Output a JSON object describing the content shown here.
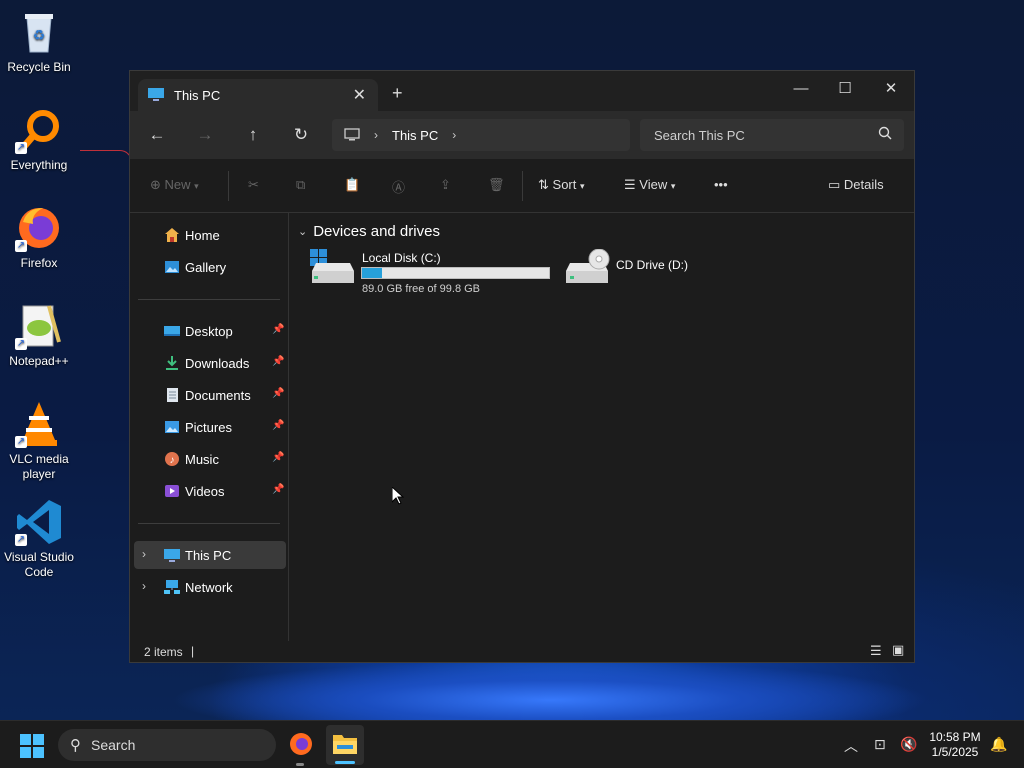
{
  "desktop": {
    "icons": [
      {
        "label": "Recycle Bin",
        "icon": "recycle-bin-icon"
      },
      {
        "label": "Everything",
        "icon": "everything-search-icon"
      },
      {
        "label": "Firefox",
        "icon": "firefox-icon"
      },
      {
        "label": "Notepad++",
        "icon": "notepad-plus-plus-icon"
      },
      {
        "label": "VLC media player",
        "icon": "vlc-icon"
      },
      {
        "label": "Visual Studio Code",
        "icon": "vscode-icon"
      }
    ]
  },
  "window": {
    "tab_title": "This PC",
    "tab_close": "✕",
    "new_tab": "+",
    "controls": {
      "minimize": "—",
      "maximize": "☐",
      "close": "✕"
    },
    "nav": {
      "back": "←",
      "forward": "→",
      "up": "↑",
      "refresh": "↻"
    },
    "breadcrumb": {
      "location": "This PC",
      "sep": "›"
    },
    "search_placeholder": "Search This PC",
    "toolbar": {
      "new_label": "New",
      "sort_label": "Sort",
      "view_label": "View",
      "more_label": "•••",
      "details_label": "Details"
    },
    "sidebar": {
      "quick": [
        {
          "label": "Home",
          "icon": "home-icon"
        },
        {
          "label": "Gallery",
          "icon": "gallery-icon"
        }
      ],
      "pinned": [
        {
          "label": "Desktop",
          "icon": "desktop-folder-icon"
        },
        {
          "label": "Downloads",
          "icon": "downloads-folder-icon"
        },
        {
          "label": "Documents",
          "icon": "documents-folder-icon"
        },
        {
          "label": "Pictures",
          "icon": "pictures-folder-icon"
        },
        {
          "label": "Music",
          "icon": "music-folder-icon"
        },
        {
          "label": "Videos",
          "icon": "videos-folder-icon"
        }
      ],
      "tree": [
        {
          "label": "This PC",
          "icon": "this-pc-icon"
        },
        {
          "label": "Network",
          "icon": "network-icon"
        }
      ]
    },
    "content": {
      "group_title": "Devices and drives",
      "drives": [
        {
          "name": "Local Disk (C:)",
          "free_text": "89.0 GB free of 99.8 GB",
          "used_fraction": 0.108
        },
        {
          "name": "CD Drive (D:)"
        }
      ]
    },
    "status": {
      "items_count": "2 items"
    }
  },
  "taskbar": {
    "search_label": "Search",
    "time": "10:58 PM",
    "date": "1/5/2025"
  },
  "colors": {
    "accent": "#26a0da",
    "window_bg": "#1c1c1c",
    "selected": "#3a3a3a"
  }
}
